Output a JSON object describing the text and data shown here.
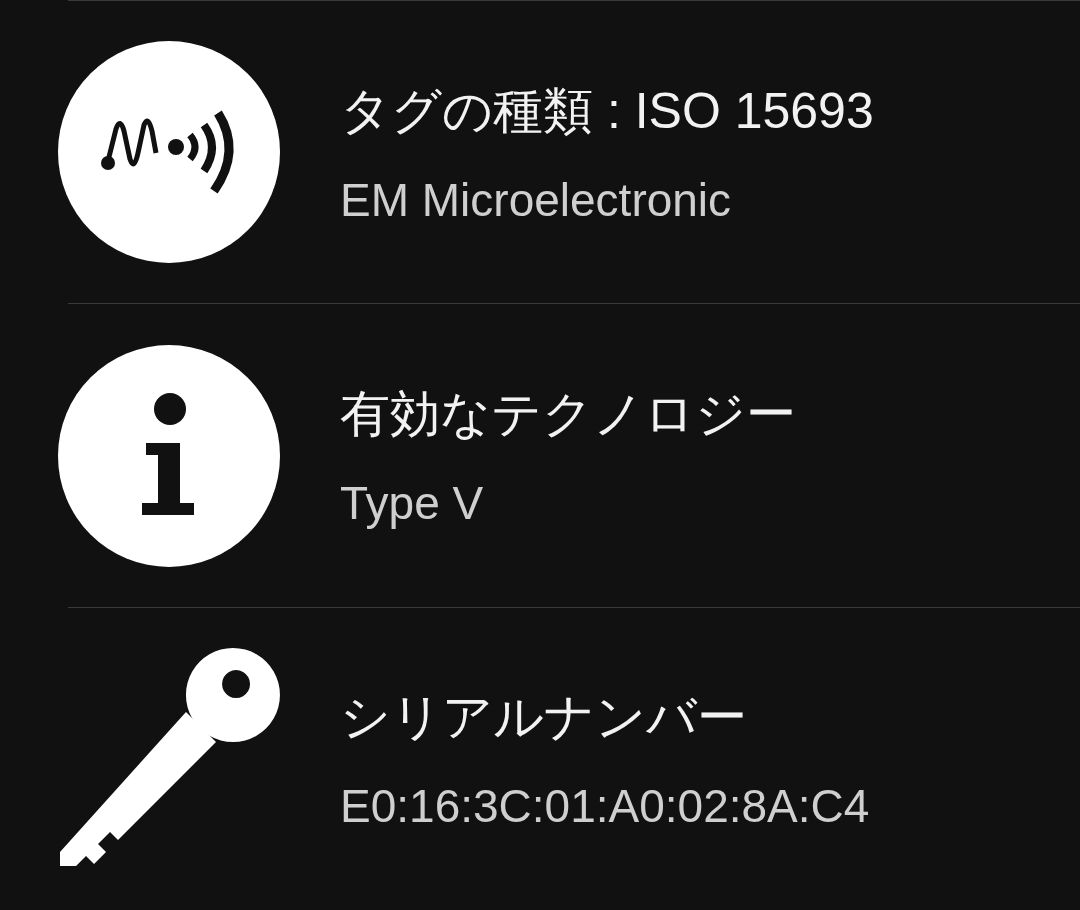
{
  "rows": [
    {
      "kind": "nfc",
      "title": "タグの種類 : ISO 15693",
      "subtitle": "EM Microelectronic"
    },
    {
      "kind": "info",
      "title": "有効なテクノロジー",
      "subtitle": "Type V"
    },
    {
      "kind": "key",
      "title": "シリアルナンバー",
      "subtitle": "E0:16:3C:01:A0:02:8A:C4"
    }
  ]
}
